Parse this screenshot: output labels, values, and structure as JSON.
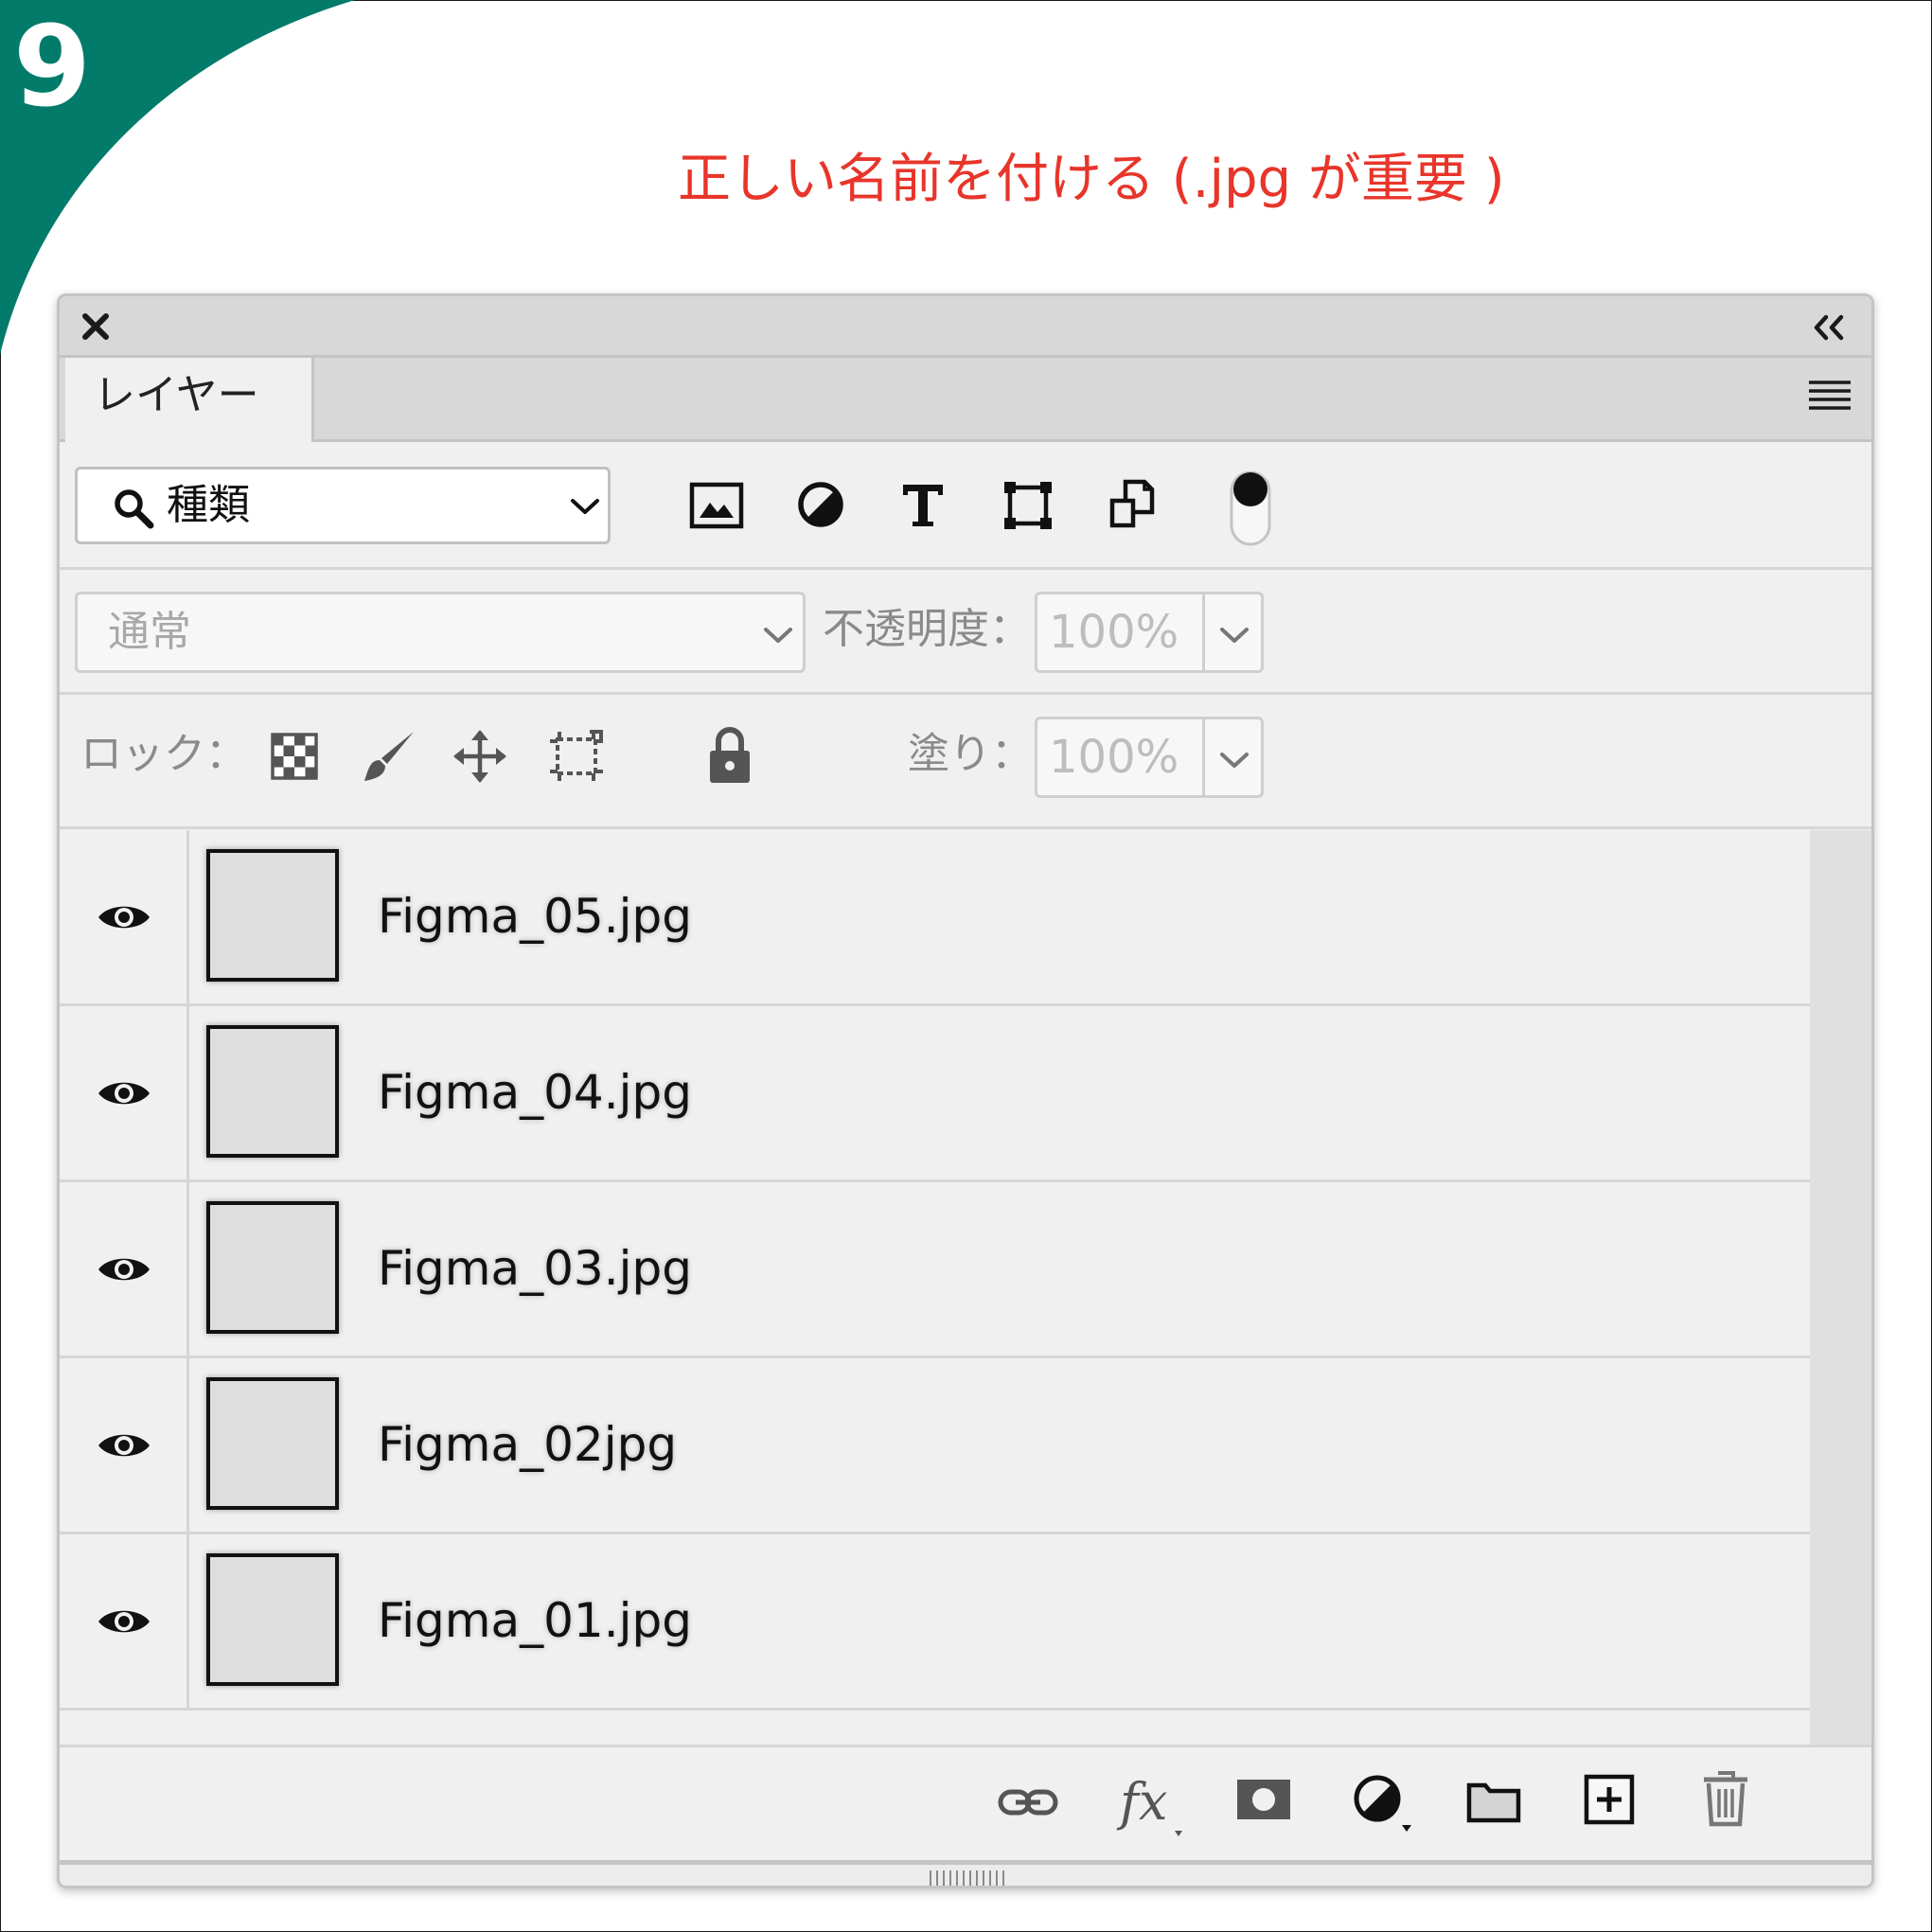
{
  "step_number": "9",
  "caption": "正しい名前を付ける (.jpg が重要 )",
  "colors": {
    "teal": "#037b6a",
    "caption_red": "#e8352a"
  },
  "panel": {
    "tab_label": "レイヤー",
    "filter": {
      "kind_label": "種類",
      "icons": [
        "pixel-layer-filter-icon",
        "adjustment-layer-filter-icon",
        "type-layer-filter-icon",
        "shape-layer-filter-icon",
        "smart-object-filter-icon",
        "filter-toggle-switch"
      ]
    },
    "blend_mode": "通常",
    "opacity_label": "不透明度：",
    "opacity_value": "100%",
    "lock_label": "ロック：",
    "fill_label": "塗り：",
    "fill_value": "100%",
    "layers": [
      {
        "name": "Figma_05.jpg"
      },
      {
        "name": "Figma_04.jpg"
      },
      {
        "name": "Figma_03.jpg"
      },
      {
        "name": "Figma_02jpg"
      },
      {
        "name": "Figma_01.jpg"
      }
    ],
    "bottom_icons": [
      "link-icon",
      "fx-icon",
      "mask-icon",
      "adjustment-icon",
      "folder-icon",
      "new-layer-icon",
      "trash-icon"
    ]
  }
}
